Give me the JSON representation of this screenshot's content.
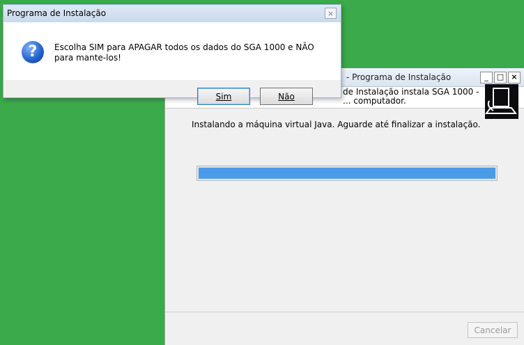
{
  "installer": {
    "title": "- Programa de Instalação",
    "description": "de Instalação instala SGA 1000 - ... computador.",
    "status": "Instalando a máquina virtual Java. Aguarde até finalizar a instalação.",
    "progress": 1.0,
    "cancel_label": "Cancelar",
    "minimize_glyph": "_",
    "maximize_glyph": "□",
    "close_glyph": "×"
  },
  "dialog": {
    "title": "Programa de Instalação",
    "icon": "question-icon",
    "icon_glyph": "?",
    "message": "Escolha SIM para APAGAR todos os dados do SGA 1000 e NÃO para mante-los!",
    "yes_label": "Sim",
    "no_label": "Não",
    "close_glyph": "×"
  },
  "colors": {
    "background": "#3aaa4a",
    "progress": "#4a9be8"
  }
}
